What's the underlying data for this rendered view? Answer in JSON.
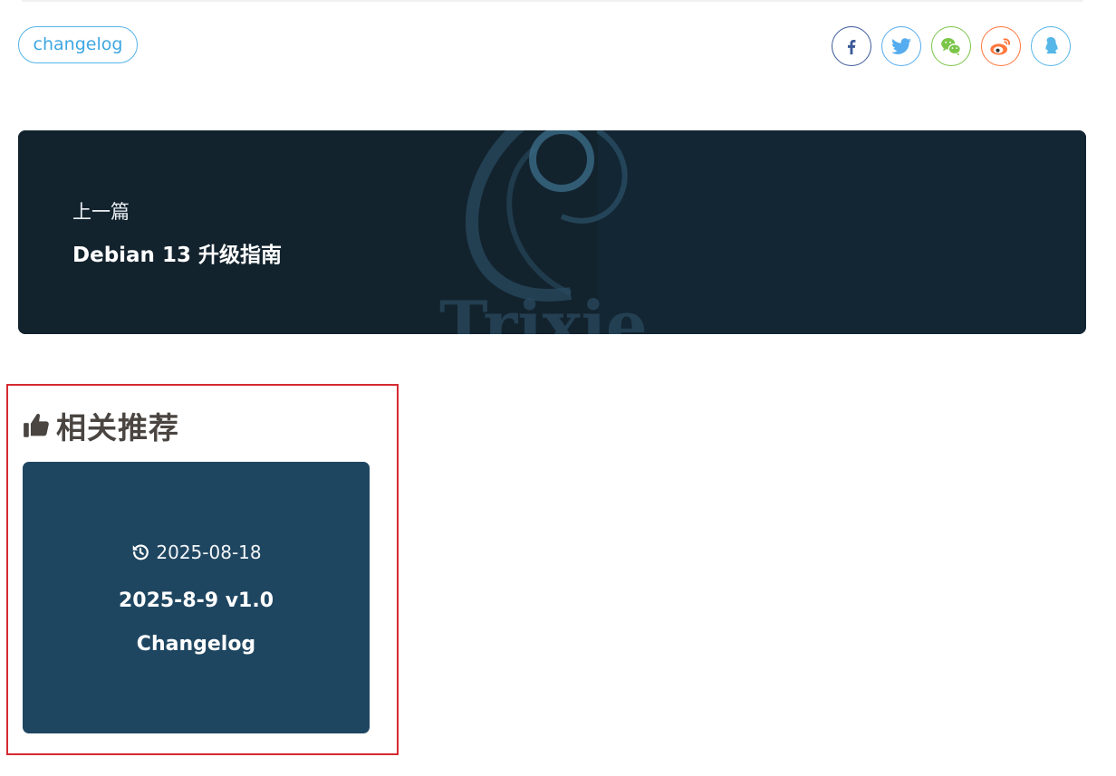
{
  "tag": {
    "label": "changelog"
  },
  "share": {
    "buttons": [
      {
        "name": "facebook",
        "icon": "facebook-icon",
        "color": "#3b5998"
      },
      {
        "name": "twitter",
        "icon": "twitter-icon",
        "color": "#55acee"
      },
      {
        "name": "wechat",
        "icon": "wechat-icon",
        "color": "#7bc549"
      },
      {
        "name": "weibo",
        "icon": "weibo-icon",
        "color": "#ff763b"
      },
      {
        "name": "qq",
        "icon": "qq-icon",
        "color": "#56b6e7"
      }
    ]
  },
  "prev_post": {
    "label": "上一篇",
    "title": "Debian 13 升级指南",
    "bg_watermark": "Trixie"
  },
  "related": {
    "title": "相关推荐",
    "icon": "thumbs-up-icon",
    "items": [
      {
        "date": "2025-08-18",
        "date_icon": "history-icon",
        "title": "2025-8-9 v1.0\nChangelog"
      }
    ]
  },
  "colors": {
    "accent": "#3ea7e2",
    "highlight_border": "#d62a31",
    "card_bg": "#1f4661",
    "prev_bg": "#13222d"
  }
}
